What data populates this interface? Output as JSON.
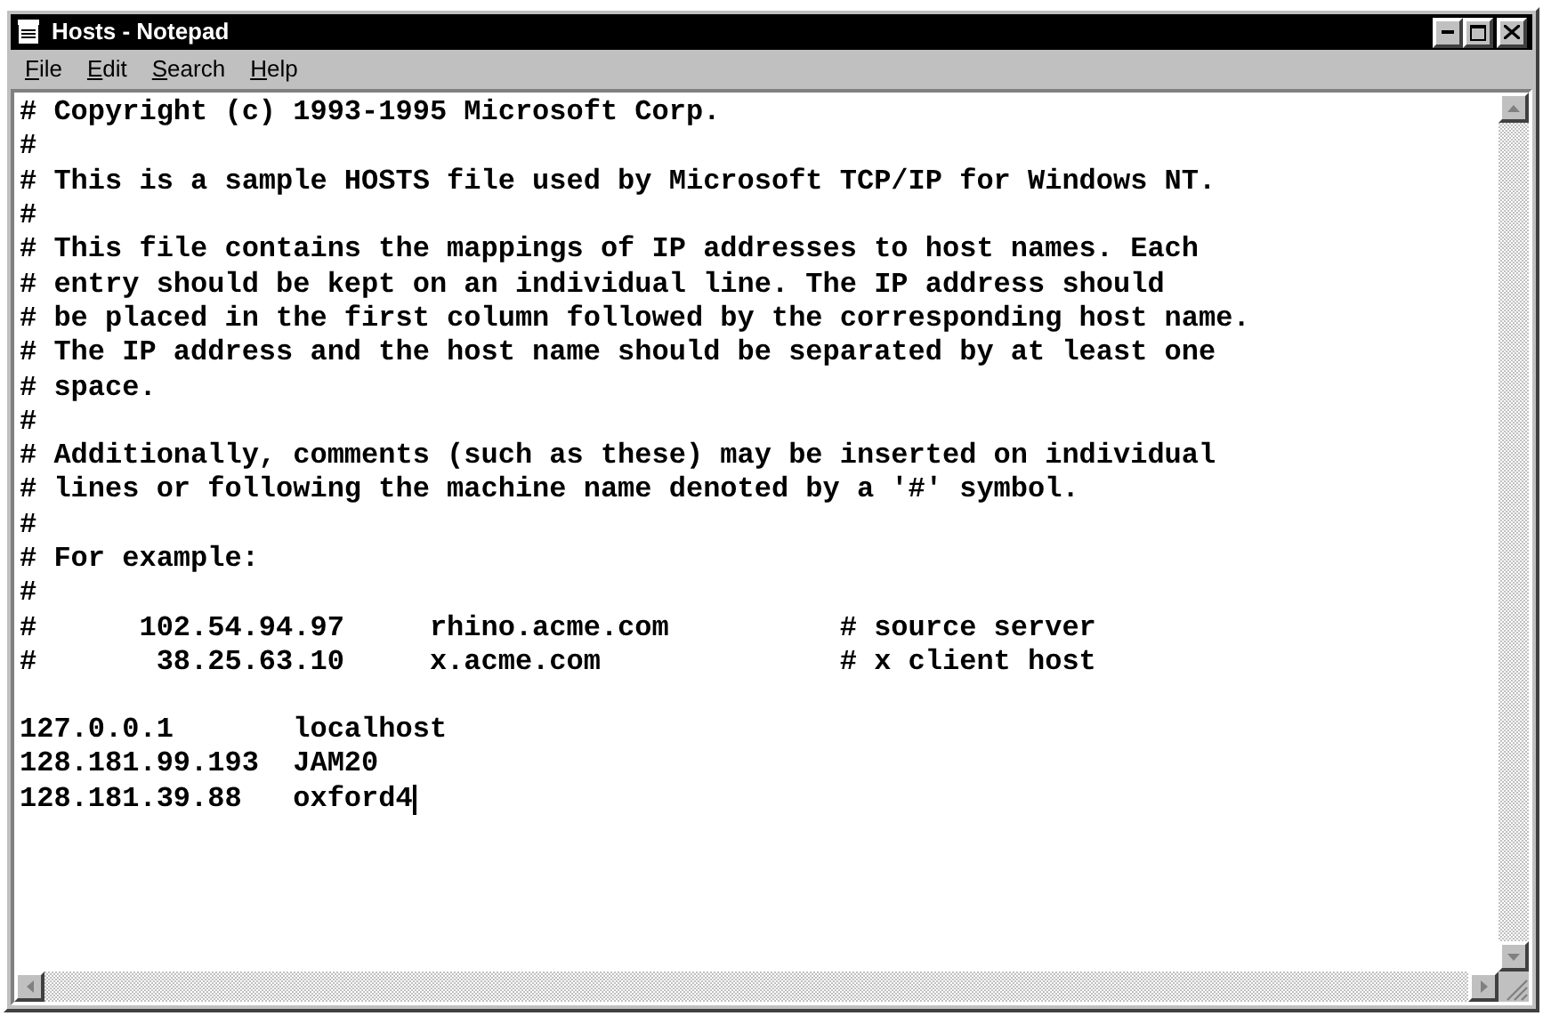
{
  "window": {
    "title": "Hosts - Notepad"
  },
  "menu": [
    {
      "label": "File"
    },
    {
      "label": "Edit"
    },
    {
      "label": "Search"
    },
    {
      "label": "Help"
    }
  ],
  "editor": {
    "blocks": [
      [
        "# Copyright (c) 1993-1995 Microsoft Corp.",
        "#",
        "# This is a sample HOSTS file used by Microsoft TCP/IP for Windows NT.",
        "#",
        "# This file contains the mappings of IP addresses to host names. Each",
        "# entry should be kept on an individual line. The IP address should",
        "# be placed in the first column followed by the corresponding host name.",
        "# The IP address and the host name should be separated by at least one",
        "# space.",
        "#",
        "# Additionally, comments (such as these) may be inserted on individual",
        "# lines or following the machine name denoted by a '#' symbol.",
        "#",
        "# For example:",
        "#",
        "#      102.54.94.97     rhino.acme.com          # source server",
        "#       38.25.63.10     x.acme.com              # x client host"
      ],
      [
        "127.0.0.1       localhost",
        "128.181.99.193  JAM20",
        "128.181.39.88   oxford4"
      ]
    ],
    "cursor_at_end": true
  }
}
